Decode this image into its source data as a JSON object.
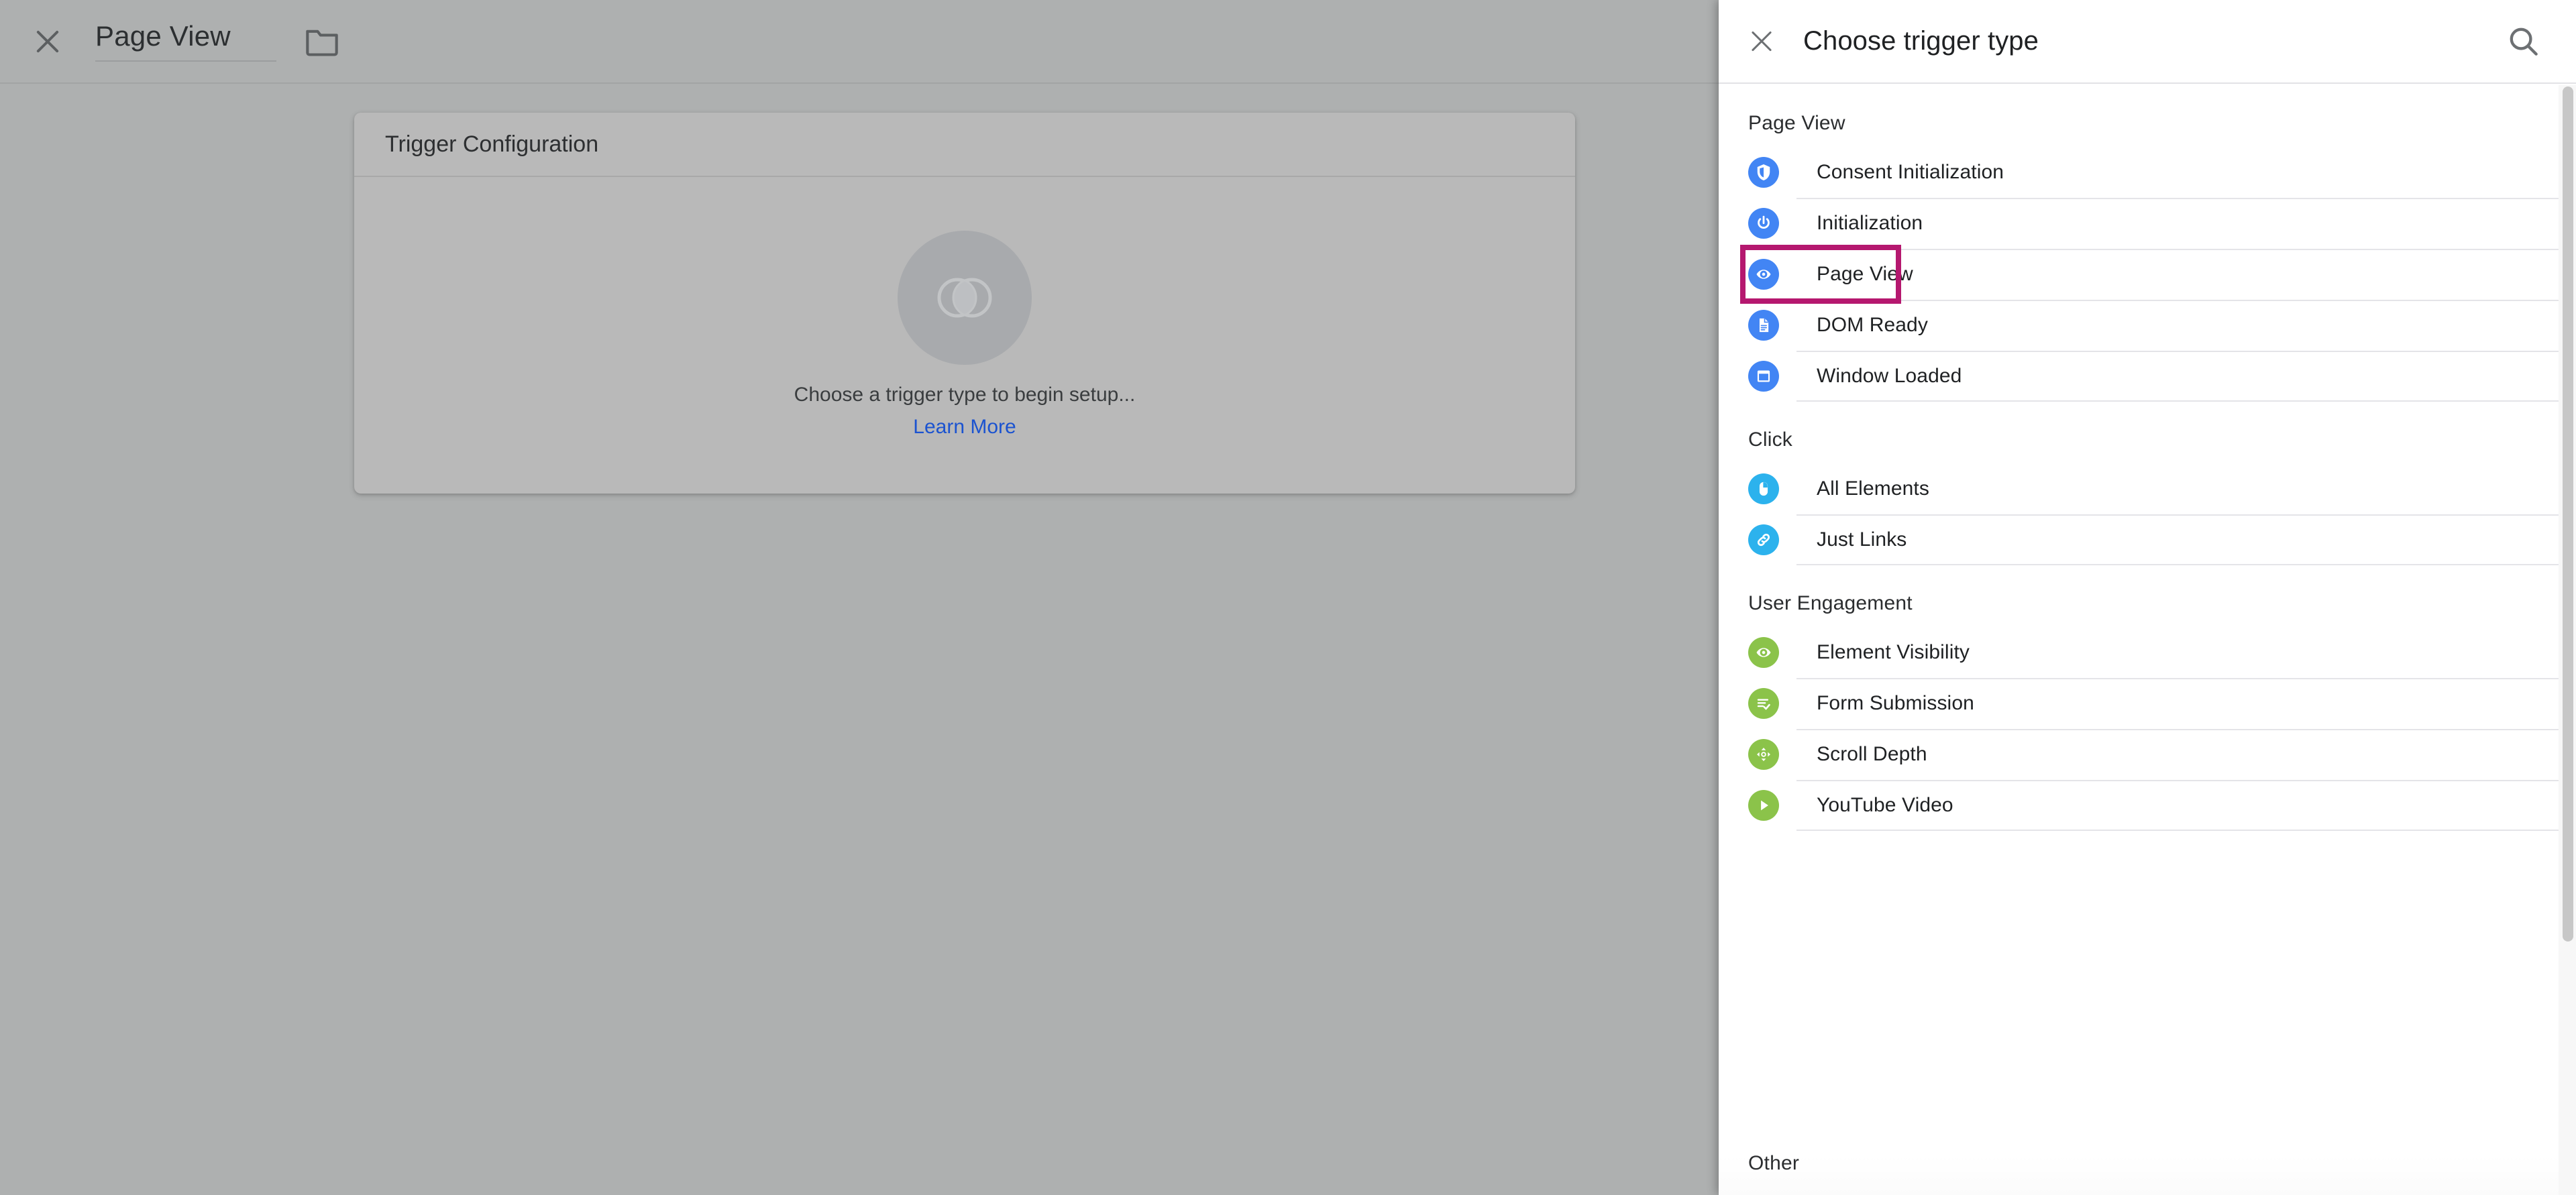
{
  "left": {
    "close_icon": "close-icon",
    "trigger_name": "Page View",
    "folder_icon": "folder-icon",
    "card": {
      "header": "Trigger Configuration",
      "placeholder_icon": "trigger-placeholder-icon",
      "empty_text": "Choose a trigger type to begin setup...",
      "learn_more": "Learn More"
    }
  },
  "panel": {
    "close_icon": "close-icon",
    "title": "Choose trigger type",
    "search_icon": "search-icon",
    "highlighted_item": "Page View",
    "highlight_color": "#b5186f",
    "sections": [
      {
        "name": "Page View",
        "items": [
          {
            "label": "Consent Initialization",
            "icon": "shield-icon",
            "color": "#4285f4"
          },
          {
            "label": "Initialization",
            "icon": "power-icon",
            "color": "#4285f4"
          },
          {
            "label": "Page View",
            "icon": "eye-icon",
            "color": "#4285f4"
          },
          {
            "label": "DOM Ready",
            "icon": "document-icon",
            "color": "#4285f4"
          },
          {
            "label": "Window Loaded",
            "icon": "window-icon",
            "color": "#4285f4"
          }
        ]
      },
      {
        "name": "Click",
        "items": [
          {
            "label": "All Elements",
            "icon": "mouse-icon",
            "color": "#2cb2ed"
          },
          {
            "label": "Just Links",
            "icon": "link-icon",
            "color": "#2cb2ed"
          }
        ]
      },
      {
        "name": "User Engagement",
        "items": [
          {
            "label": "Element Visibility",
            "icon": "eye-icon",
            "color": "#8bc34a"
          },
          {
            "label": "Form Submission",
            "icon": "form-check-icon",
            "color": "#8bc34a"
          },
          {
            "label": "Scroll Depth",
            "icon": "scroll-arrows-icon",
            "color": "#8bc34a"
          },
          {
            "label": "YouTube Video",
            "icon": "play-icon",
            "color": "#8bc34a"
          }
        ]
      },
      {
        "name": "Other",
        "items": []
      }
    ]
  }
}
